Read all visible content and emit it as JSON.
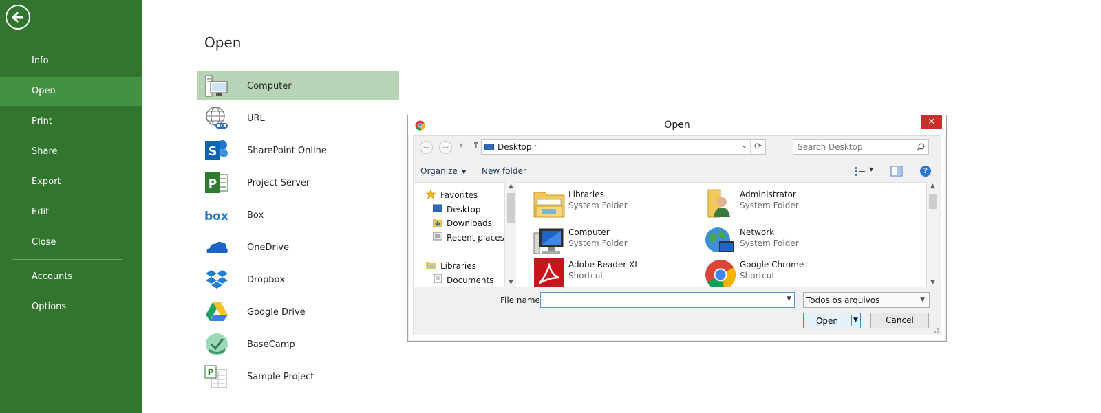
{
  "backstage": {
    "nav": {
      "items": [
        {
          "label": "Info"
        },
        {
          "label": "Open",
          "active": true
        },
        {
          "label": "Print"
        },
        {
          "label": "Share"
        },
        {
          "label": "Export"
        },
        {
          "label": "Edit"
        },
        {
          "label": "Close"
        },
        {
          "label": "Accounts"
        },
        {
          "label": "Options"
        }
      ]
    },
    "page_title": "Open",
    "places": [
      {
        "label": "Computer",
        "icon": "computer-icon",
        "selected": true
      },
      {
        "label": "URL",
        "icon": "globe-link-icon"
      },
      {
        "label": "SharePoint Online",
        "icon": "sharepoint-icon"
      },
      {
        "label": "Project Server",
        "icon": "project-server-icon"
      },
      {
        "label": "Box",
        "icon": "box-icon"
      },
      {
        "label": "OneDrive",
        "icon": "onedrive-icon"
      },
      {
        "label": "Dropbox",
        "icon": "dropbox-icon"
      },
      {
        "label": "Google Drive",
        "icon": "google-drive-icon"
      },
      {
        "label": "BaseCamp",
        "icon": "basecamp-icon"
      },
      {
        "label": "Sample Project",
        "icon": "sample-project-icon"
      }
    ]
  },
  "dialog": {
    "title": "Open",
    "close_label": "✕",
    "address": {
      "location": "Desktop"
    },
    "search": {
      "placeholder": "Search Desktop"
    },
    "toolbar": {
      "organize_label": "Organize",
      "new_folder_label": "New folder"
    },
    "tree": [
      {
        "label": "Favorites",
        "icon": "star-icon"
      },
      {
        "label": "Desktop",
        "icon": "desktop-icon"
      },
      {
        "label": "Downloads",
        "icon": "downloads-icon"
      },
      {
        "label": "Recent places",
        "icon": "recent-places-icon"
      },
      {
        "label": "Libraries",
        "icon": "libraries-icon"
      },
      {
        "label": "Documents",
        "icon": "documents-icon"
      }
    ],
    "files": [
      {
        "name": "Libraries",
        "type": "System Folder",
        "icon": "libraries-folder-icon"
      },
      {
        "name": "Administrator",
        "type": "System Folder",
        "icon": "user-folder-icon"
      },
      {
        "name": "Computer",
        "type": "System Folder",
        "icon": "computer-icon"
      },
      {
        "name": "Network",
        "type": "System Folder",
        "icon": "network-icon"
      },
      {
        "name": "Adobe Reader XI",
        "type": "Shortcut",
        "icon": "adobe-reader-icon"
      },
      {
        "name": "Google Chrome",
        "type": "Shortcut",
        "icon": "chrome-icon"
      }
    ],
    "file_name_label": "File name:",
    "file_name_value": "",
    "filter": "Todos os arquivos",
    "open_label": "Open",
    "cancel_label": "Cancel"
  },
  "colors": {
    "nav_bg": "#31752f",
    "nav_active": "#439241",
    "place_selected": "#b8d4b6",
    "dialog_close": "#c7302a"
  }
}
